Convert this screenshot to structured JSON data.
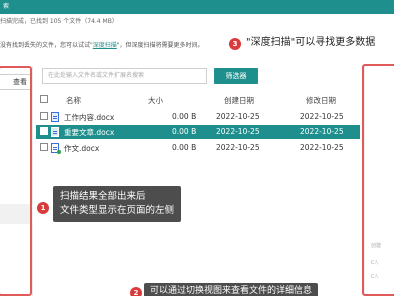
{
  "window": {
    "title": "索"
  },
  "status": {
    "text": "扫描完成，已找到 105 个文件（74.4 MB）"
  },
  "hint": {
    "prefix": "没有找到丢失的文件，您可以试试\"",
    "link": "深度扫描",
    "suffix": "\"，但深度扫描将需要更多时间。"
  },
  "left_panel": {
    "view_button": "查看"
  },
  "toolbar": {
    "search_placeholder": "在此处输入文件名或文件扩展名搜索",
    "filter_button": "筛选器"
  },
  "table": {
    "headers": [
      "名称",
      "大小",
      "创建日期",
      "修改日期"
    ],
    "rows": [
      {
        "name": "工作内容.docx",
        "size": "0.00 B",
        "created": "2022-10-25",
        "modified": "2022-10-25",
        "selected": false
      },
      {
        "name": "重要文章.docx",
        "size": "0.00 B",
        "created": "2022-10-25",
        "modified": "2022-10-25",
        "selected": true
      },
      {
        "name": "作文.docx",
        "size": "0.00 B",
        "created": "2022-10-25",
        "modified": "2022-10-25",
        "selected": false
      }
    ]
  },
  "annotations": [
    {
      "number": "1",
      "lines": [
        "扫描结果全部出来后",
        "文件类型显示在页面的左侧"
      ]
    },
    {
      "number": "2",
      "lines": [
        "可以通过切换视图来查看文件的详细信息"
      ]
    },
    {
      "number": "3",
      "lines": [
        "\"深度扫描\"可以寻找更多数据"
      ]
    }
  ],
  "right_panel": {
    "text_1": "创建",
    "text_2": "C:\\",
    "text_3": "C:\\"
  },
  "colors": {
    "accent": "#1e8f8c",
    "callout_bg": "#4d4d4d",
    "badge": "#d83b3b",
    "highlight_box": "#e05a5a"
  }
}
